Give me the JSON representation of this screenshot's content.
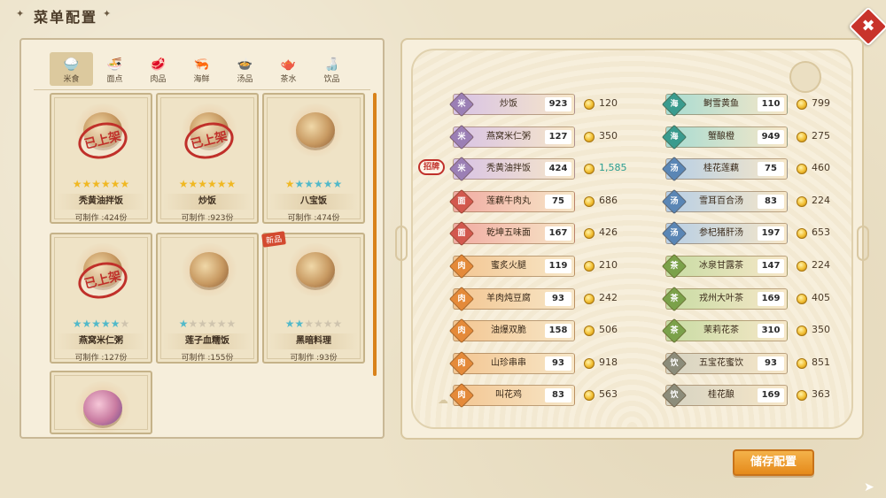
{
  "title": "菜单配置",
  "close_label": "✖",
  "save_label": "储存配置",
  "promo_label": "招牌",
  "new_label": "新品",
  "stamp_label": "已上架",
  "qty_prefix": "可制作 :",
  "qty_suffix": "份",
  "categories": [
    {
      "label": "米食",
      "icon": "🍚",
      "active": true
    },
    {
      "label": "面点",
      "icon": "🍜",
      "active": false
    },
    {
      "label": "肉品",
      "icon": "🥩",
      "active": false
    },
    {
      "label": "海鲜",
      "icon": "🦐",
      "active": false
    },
    {
      "label": "汤品",
      "icon": "🍲",
      "active": false
    },
    {
      "label": "茶水",
      "icon": "🫖",
      "active": false
    },
    {
      "label": "饮品",
      "icon": "🍶",
      "active": false
    }
  ],
  "cards": [
    {
      "name": "秃黄油拌饭",
      "qty": "可制作 :424份",
      "stars": "gold",
      "filled": 6,
      "stamp": true,
      "new": false
    },
    {
      "name": "炒饭",
      "qty": "可制作 :923份",
      "stars": "gold",
      "filled": 6,
      "stamp": true,
      "new": false
    },
    {
      "name": "八宝饭",
      "qty": "可制作 :474份",
      "stars": "gold-blue",
      "filled": 1,
      "stamp": false,
      "new": false
    },
    {
      "name": "燕窝米仁粥",
      "qty": "可制作 :127份",
      "stars": "blue",
      "filled": 5,
      "stamp": true,
      "new": false
    },
    {
      "name": "莲子血糯饭",
      "qty": "可制作 :155份",
      "stars": "blue",
      "filled": 1,
      "stamp": false,
      "new": false
    },
    {
      "name": "黑暗料理",
      "qty": "可制作 :93份",
      "stars": "blue",
      "filled": 2,
      "stamp": false,
      "new": true
    }
  ],
  "menu_left": [
    {
      "cat": "米",
      "color": "#9b7fb5",
      "bar": "#d8c3e6",
      "name": "炒饭",
      "count": "923",
      "price": "120"
    },
    {
      "cat": "米",
      "color": "#9b7fb5",
      "bar": "#d8c3e6",
      "name": "燕窝米仁粥",
      "count": "127",
      "price": "350"
    },
    {
      "cat": "米",
      "color": "#9b7fb5",
      "bar": "#d8c3e6",
      "name": "秃黄油拌饭",
      "count": "424",
      "price": "1,585",
      "highlight": true
    },
    {
      "cat": "面",
      "color": "#d2584e",
      "bar": "#f1aca3",
      "name": "莲藕牛肉丸",
      "count": "75",
      "price": "686"
    },
    {
      "cat": "面",
      "color": "#d2584e",
      "bar": "#f1aca3",
      "name": "乾坤五味面",
      "count": "167",
      "price": "426"
    },
    {
      "cat": "肉",
      "color": "#e48a3a",
      "bar": "#f3c692",
      "name": "蜜炙火腿",
      "count": "119",
      "price": "210"
    },
    {
      "cat": "肉",
      "color": "#e48a3a",
      "bar": "#f3c692",
      "name": "羊肉炖豆腐",
      "count": "93",
      "price": "242"
    },
    {
      "cat": "肉",
      "color": "#e48a3a",
      "bar": "#f3c692",
      "name": "油爆双脆",
      "count": "158",
      "price": "506"
    },
    {
      "cat": "肉",
      "color": "#e48a3a",
      "bar": "#f3c692",
      "name": "山珍串串",
      "count": "93",
      "price": "918"
    },
    {
      "cat": "肉",
      "color": "#e48a3a",
      "bar": "#f3c692",
      "name": "叫花鸡",
      "count": "83",
      "price": "563"
    }
  ],
  "menu_right": [
    {
      "cat": "海",
      "color": "#3a9b8e",
      "bar": "#a8dcd2",
      "name": "鲥雪黄鱼",
      "count": "110",
      "price": "799"
    },
    {
      "cat": "海",
      "color": "#3a9b8e",
      "bar": "#a8dcd2",
      "name": "蟹酿橙",
      "count": "949",
      "price": "275"
    },
    {
      "cat": "汤",
      "color": "#5a86b5",
      "bar": "#b7cfe6",
      "name": "桂花莲藕",
      "count": "75",
      "price": "460"
    },
    {
      "cat": "汤",
      "color": "#5a86b5",
      "bar": "#b7cfe6",
      "name": "雪耳百合汤",
      "count": "83",
      "price": "224"
    },
    {
      "cat": "汤",
      "color": "#5a86b5",
      "bar": "#b7cfe6",
      "name": "参杞猪肝汤",
      "count": "197",
      "price": "653"
    },
    {
      "cat": "茶",
      "color": "#7ba14a",
      "bar": "#c8dca4",
      "name": "冰泉甘露茶",
      "count": "147",
      "price": "224"
    },
    {
      "cat": "茶",
      "color": "#7ba14a",
      "bar": "#c8dca4",
      "name": "戎州大叶茶",
      "count": "169",
      "price": "405"
    },
    {
      "cat": "茶",
      "color": "#7ba14a",
      "bar": "#c8dca4",
      "name": "茉莉花茶",
      "count": "310",
      "price": "350"
    },
    {
      "cat": "饮",
      "color": "#8c8c7a",
      "bar": "#d6d3c2",
      "name": "五宝花蜜饮",
      "count": "93",
      "price": "851"
    },
    {
      "cat": "饮",
      "color": "#8c8c7a",
      "bar": "#d6d3c2",
      "name": "桂花酿",
      "count": "169",
      "price": "363"
    }
  ]
}
